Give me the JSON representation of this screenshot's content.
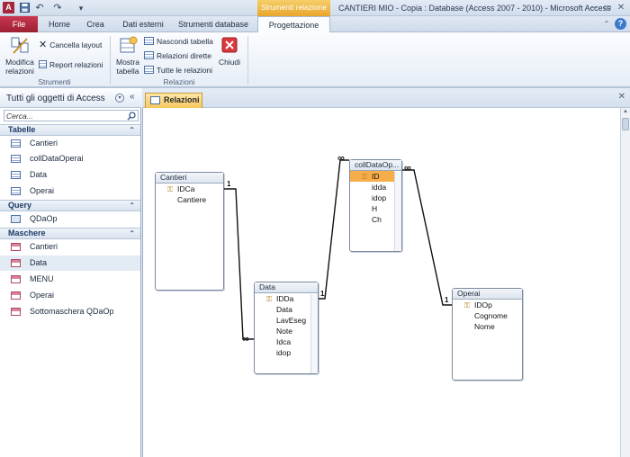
{
  "app": {
    "icon_letter": "A",
    "title": "CANTIERI MIO - Copia : Database (Access 2007 - 2010) - Microsoft Access",
    "context_band": "Strumenti relazione"
  },
  "quick_access": {
    "save": "save-icon",
    "undo": "↶",
    "redo": "↷",
    "customize": "▾"
  },
  "window_controls": {
    "minimize": "–",
    "restore": "▭",
    "close": "✕",
    "help": "?"
  },
  "ribbon_tabs": [
    "File",
    "Home",
    "Crea",
    "Dati esterni",
    "Strumenti database",
    "Progettazione"
  ],
  "ribbon": {
    "strumenti": {
      "label": "Strumenti",
      "modifica": "Modifica relazioni",
      "cancella": "Cancella layout",
      "report": "Report relazioni"
    },
    "relazioni": {
      "label": "Relazioni",
      "mostra": "Mostra tabella",
      "nascondi": "Nascondi tabella",
      "dirette": "Relazioni dirette",
      "tutte": "Tutte le relazioni",
      "chiudi": "Chiudi"
    }
  },
  "nav": {
    "title": "Tutti gli oggetti di Access",
    "search_placeholder": "Cerca...",
    "categories": [
      {
        "name": "Tabelle",
        "items": [
          "Cantieri",
          "collDataOperai",
          "Data",
          "Operai"
        ]
      },
      {
        "name": "Query",
        "items": [
          "QDaOp"
        ]
      },
      {
        "name": "Maschere",
        "items": [
          "Cantieri",
          "Data",
          "MENU",
          "Operai",
          "Sottomaschera QDaOp"
        ]
      }
    ],
    "selected": "Data"
  },
  "document": {
    "tab_label": "Relazioni",
    "close": "✕"
  },
  "tables": [
    {
      "name": "Cantieri",
      "fields": [
        "IDCa",
        "Cantiere"
      ],
      "key_field": 0
    },
    {
      "name": "collDataOp...",
      "fields": [
        "ID",
        "idda",
        "idop",
        "H",
        "Ch"
      ],
      "key_field": 0,
      "highlighted": 0
    },
    {
      "name": "Data",
      "fields": [
        "IDDa",
        "Data",
        "LavEseg",
        "Note",
        "Idca",
        "idop"
      ],
      "key_field": 0
    },
    {
      "name": "Operai",
      "fields": [
        "IDOp",
        "Cognome",
        "Nome"
      ],
      "key_field": 0
    }
  ],
  "relations": [
    {
      "one_label": "1",
      "many_label": "∞"
    },
    {
      "one_label": "1",
      "many_label": "∞"
    },
    {
      "one_label": "1",
      "many_label": "∞"
    }
  ],
  "colors": {
    "accent": "#f7ae4a",
    "file_tab": "#b22a41",
    "context": "#eeb43f"
  }
}
